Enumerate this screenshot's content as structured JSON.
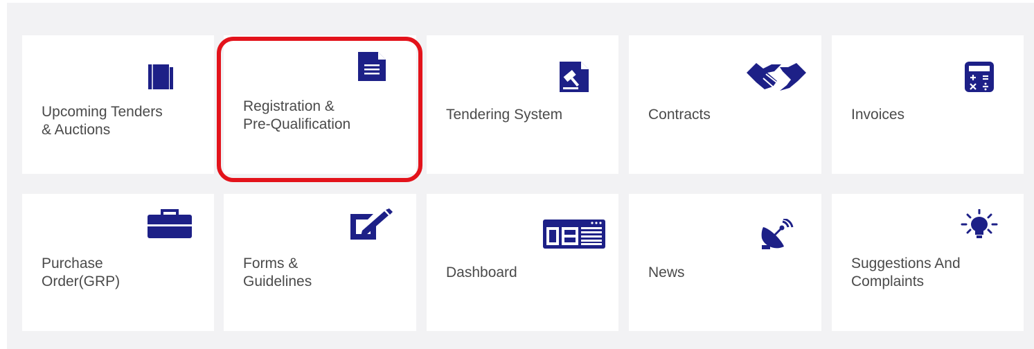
{
  "colors": {
    "icon": "#1d2087",
    "highlight": "#e3131b",
    "text": "#4a4a4a",
    "panel": "#f2f2f4"
  },
  "tiles": [
    {
      "label": "Upcoming Tenders\n& Auctions",
      "icon": "book-icon"
    },
    {
      "label": "Registration &\nPre-Qualification",
      "icon": "document-icon"
    },
    {
      "label": "Tendering System",
      "icon": "gavel-document-icon"
    },
    {
      "label": "Contracts",
      "icon": "handshake-icon"
    },
    {
      "label": "Invoices",
      "icon": "calculator-icon"
    },
    {
      "label": "Purchase\nOrder(GRP)",
      "icon": "briefcase-icon"
    },
    {
      "label": "Forms &\nGuidelines",
      "icon": "edit-form-icon"
    },
    {
      "label": "Dashboard",
      "icon": "dashboard-icon"
    },
    {
      "label": "News",
      "icon": "satellite-dish-icon"
    },
    {
      "label": "Suggestions And\nComplaints",
      "icon": "lightbulb-icon"
    }
  ]
}
